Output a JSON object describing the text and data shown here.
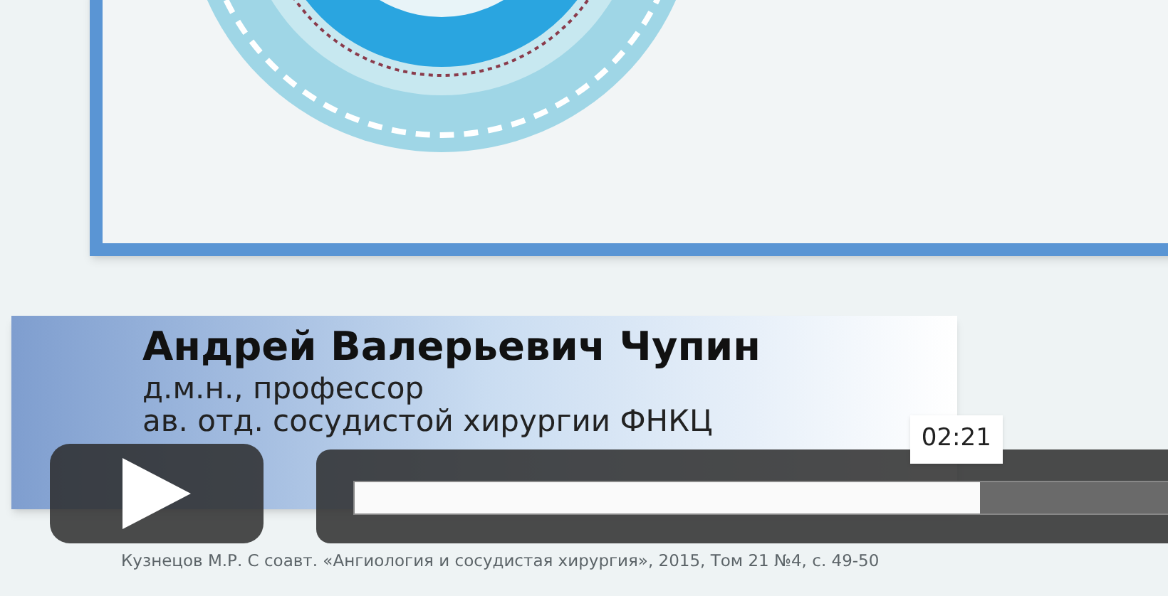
{
  "slide": {
    "name": "Андрей Валерьевич Чупин",
    "subtitle_lines": [
      "д.м.н., профессор",
      "ав. отд. сосудистой хирургии ФНКЦ"
    ],
    "citation": "Кузнецов М.Р. С соавт. «Ангиология и сосудистая хирургия», 2015, Том 21 №4, с. 49-50"
  },
  "player": {
    "playing": false,
    "level": 0.77,
    "time_tooltip": "02:21"
  }
}
